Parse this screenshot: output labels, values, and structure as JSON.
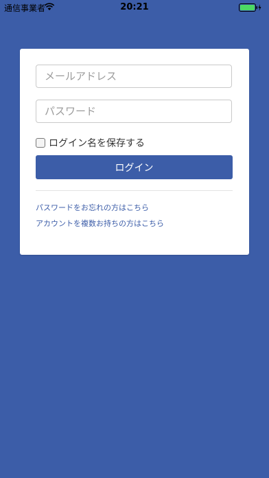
{
  "statusbar": {
    "carrier": "通信事業者",
    "time": "20:21"
  },
  "login": {
    "email_placeholder": "メールアドレス",
    "password_placeholder": "パスワード",
    "remember_label": "ログイン名を保存する",
    "remember_checked": false,
    "submit_label": "ログイン",
    "forgot_password_link": "パスワードをお忘れの方はこちら",
    "multiple_accounts_link": "アカウントを複数お持ちの方はこちら"
  },
  "colors": {
    "background": "#3c5da8",
    "accent": "#3c5da8",
    "battery": "#4cd964"
  }
}
